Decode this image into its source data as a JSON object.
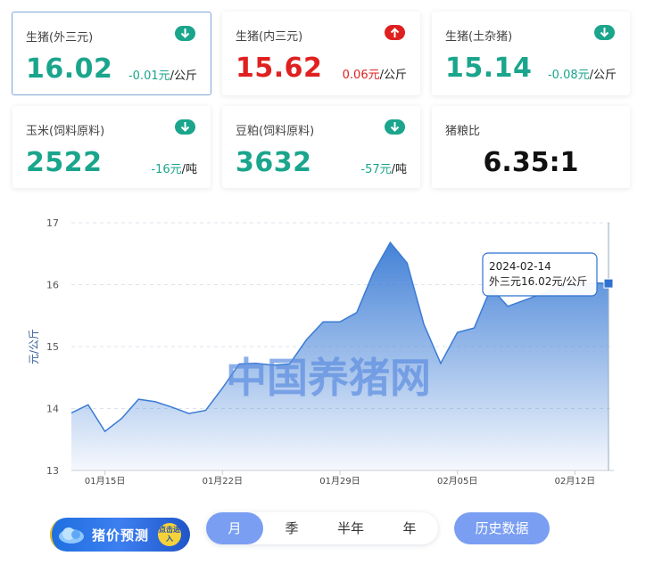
{
  "cards": [
    {
      "label": "生猪(外三元)",
      "value": "16.02",
      "change": "-0.01元",
      "unit": "/公斤",
      "trend": "down"
    },
    {
      "label": "生猪(内三元)",
      "value": "15.62",
      "change": "0.06元",
      "unit": "/公斤",
      "trend": "up"
    },
    {
      "label": "生猪(土杂猪)",
      "value": "15.14",
      "change": "-0.08元",
      "unit": "/公斤",
      "trend": "down"
    },
    {
      "label": "玉米(饲料原料)",
      "value": "2522",
      "change": "-16元",
      "unit": "/吨",
      "trend": "down"
    },
    {
      "label": "豆粕(饲料原料)",
      "value": "3632",
      "change": "-57元",
      "unit": "/吨",
      "trend": "down"
    },
    {
      "label": "猪粮比",
      "value": "6.35:1"
    }
  ],
  "colors": {
    "down": "#1aa58c",
    "up": "#e02020",
    "accent": "#7a9ef2",
    "line": "#3a7bd5"
  },
  "chart_data": {
    "type": "area",
    "ylabel": "元/公斤",
    "ylim": [
      13,
      17
    ],
    "yticks": [
      13,
      14,
      15,
      16,
      17
    ],
    "x_tick_labels": [
      "01月15日",
      "01月22日",
      "01月29日",
      "02月05日",
      "02月12日"
    ],
    "watermark": "中国养猪网",
    "series": [
      {
        "x": [
          "2024-01-13",
          "2024-01-14",
          "2024-01-15",
          "2024-01-16",
          "2024-01-17",
          "2024-01-18",
          "2024-01-19",
          "2024-01-20",
          "2024-01-21",
          "2024-01-22",
          "2024-01-23",
          "2024-01-24",
          "2024-01-25",
          "2024-01-26",
          "2024-01-27",
          "2024-01-28",
          "2024-01-29",
          "2024-01-30",
          "2024-01-31",
          "2024-02-01",
          "2024-02-02",
          "2024-02-03",
          "2024-02-04",
          "2024-02-05",
          "2024-02-06",
          "2024-02-07",
          "2024-02-08",
          "2024-02-09",
          "2024-02-10",
          "2024-02-11",
          "2024-02-12",
          "2024-02-13",
          "2024-02-14"
        ],
        "values": [
          13.93,
          14.06,
          13.63,
          13.84,
          14.15,
          14.11,
          14.02,
          13.92,
          13.97,
          14.33,
          14.72,
          14.73,
          14.7,
          14.72,
          15.11,
          15.4,
          15.4,
          15.55,
          16.2,
          16.68,
          16.35,
          15.36,
          14.73,
          15.23,
          15.3,
          15.95,
          15.65,
          15.75,
          15.85,
          15.95,
          16.0,
          16.03,
          16.02
        ]
      }
    ],
    "tooltip": {
      "date": "2024-02-14",
      "text": "外三元16.02元/公斤"
    }
  },
  "tabs": [
    "月",
    "季",
    "半年",
    "年"
  ],
  "active_tab": "月",
  "history_button": "历史数据",
  "predict_button": "猪价预测",
  "predict_badge": "点击进入"
}
